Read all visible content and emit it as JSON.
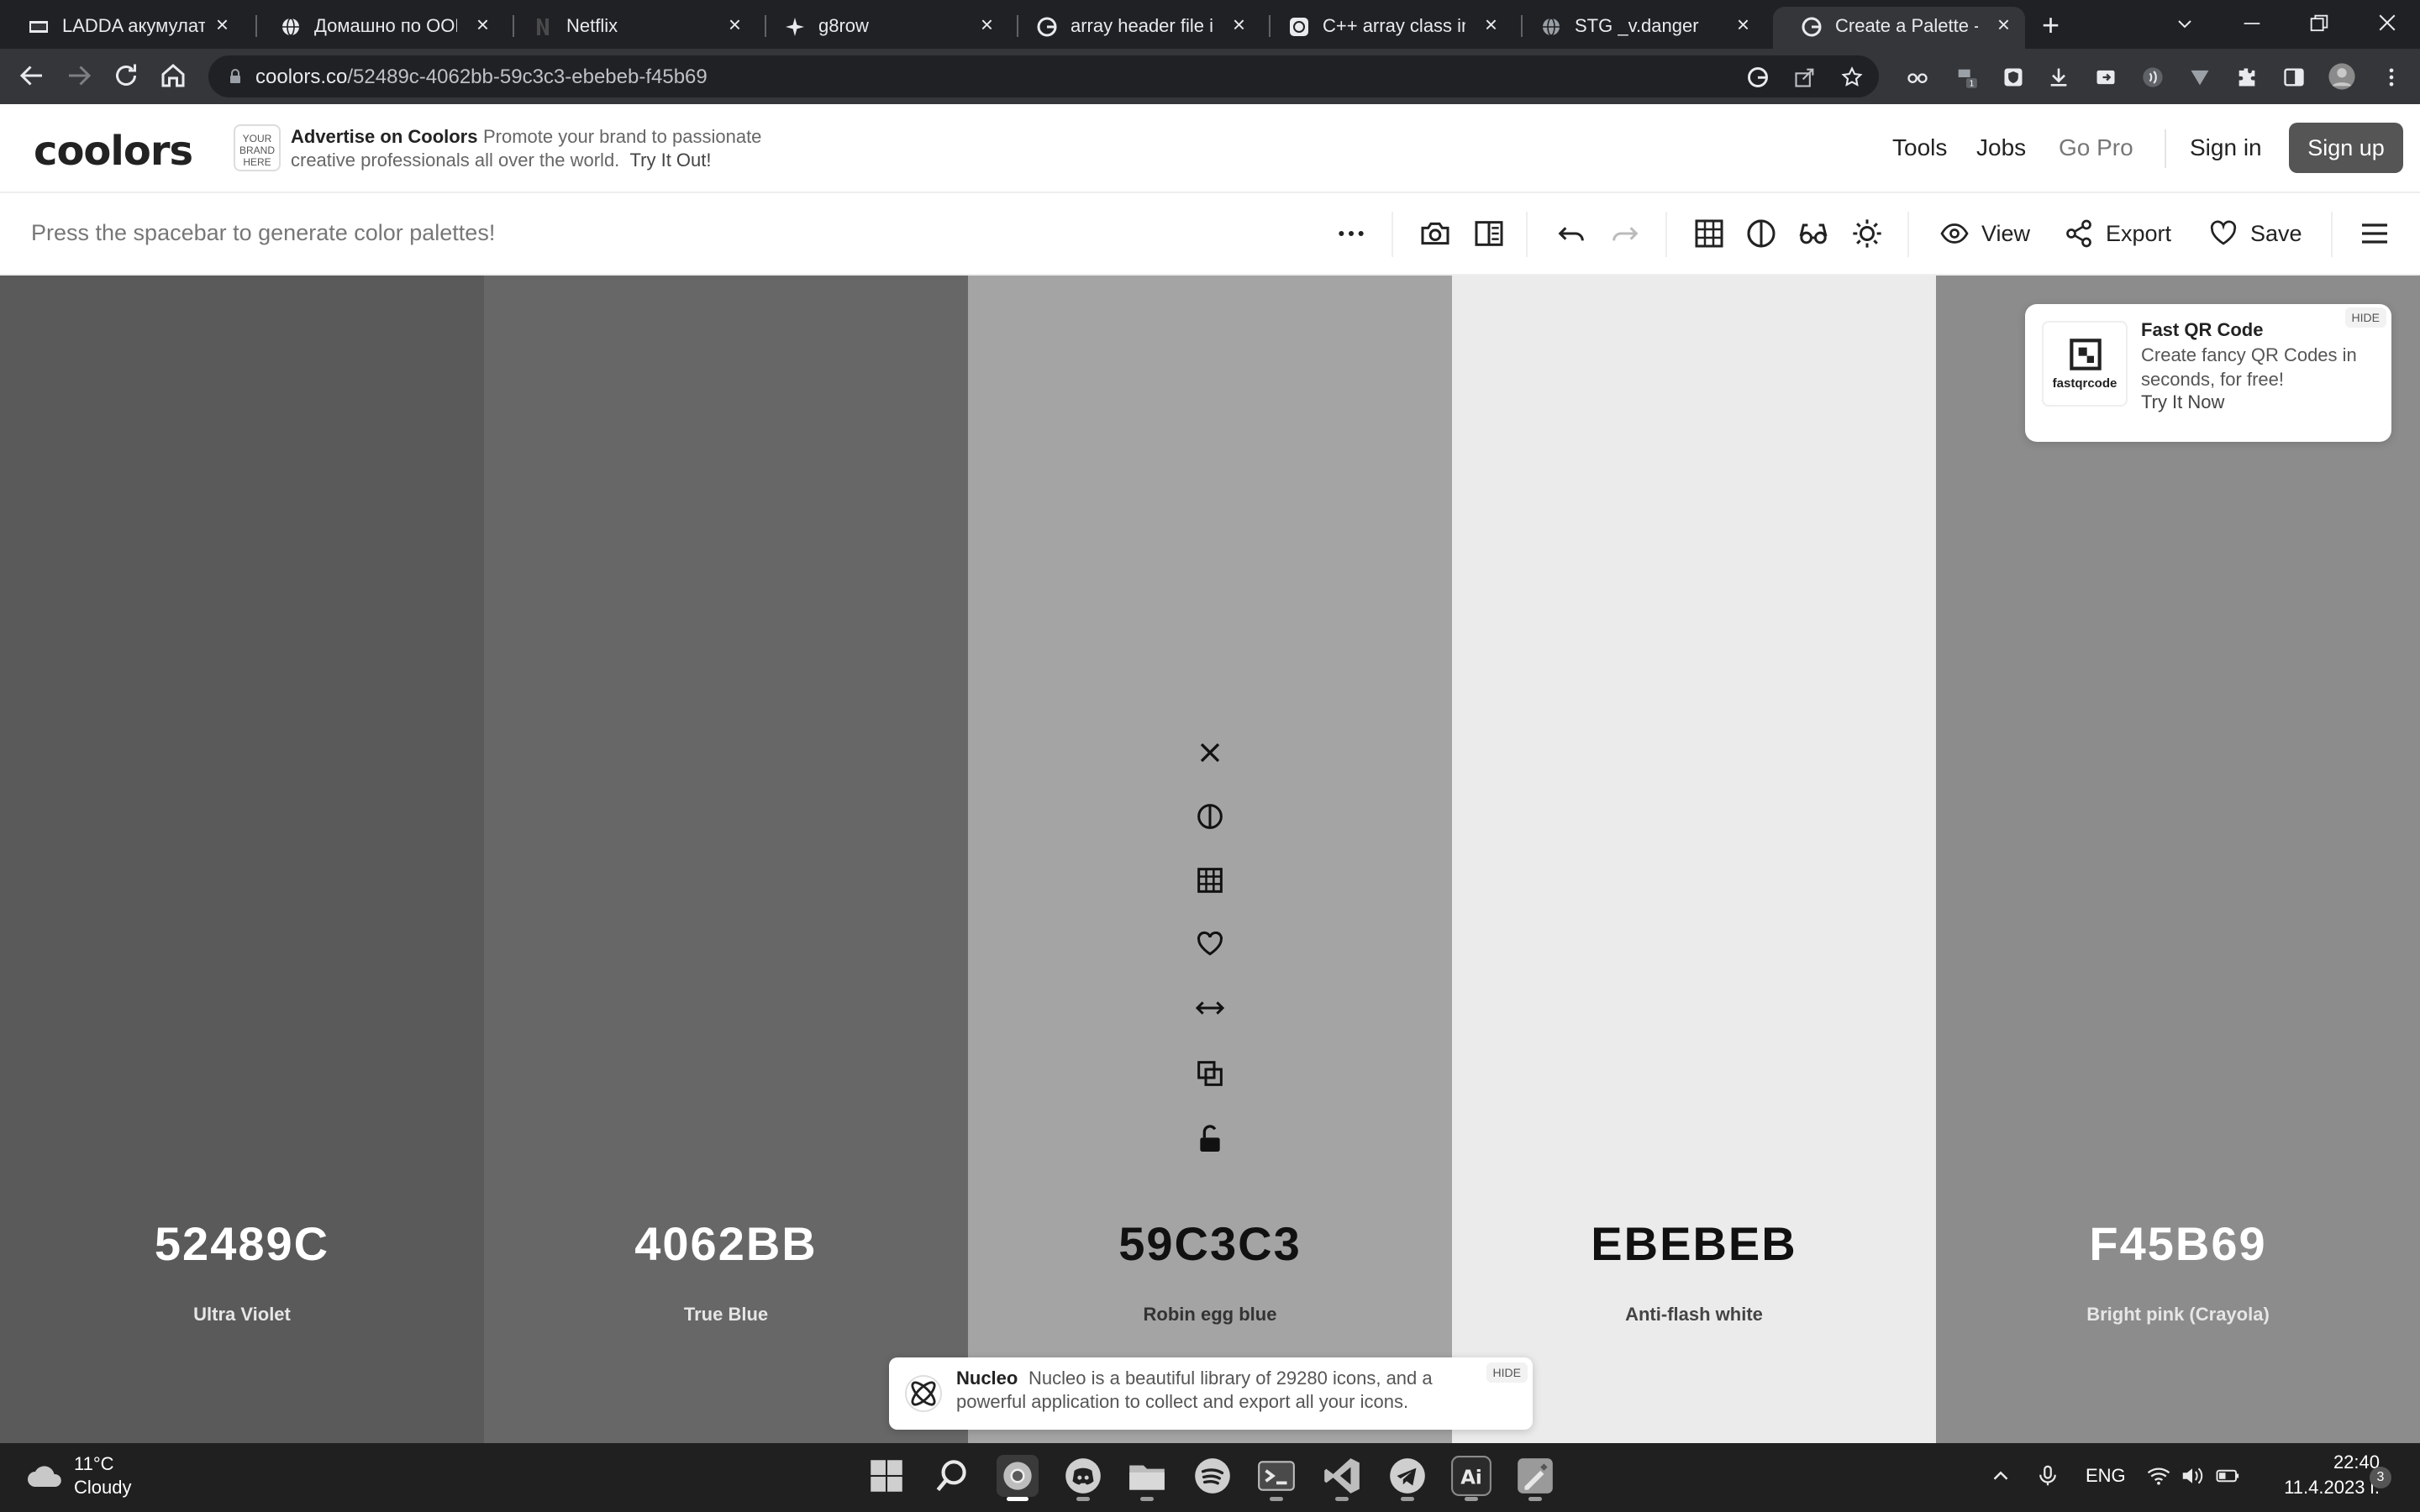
{
  "browser": {
    "tabs": [
      {
        "label": "LADDA акумулатори",
        "favicon": "ikea-favicon"
      },
      {
        "label": "Домашно по ООП",
        "favicon": "globe-favicon"
      },
      {
        "label": "Netflix",
        "favicon": "netflix-favicon"
      },
      {
        "label": "g8row",
        "favicon": "star-favicon"
      },
      {
        "label": "array header file in c",
        "favicon": "google-favicon"
      },
      {
        "label": "C++ array class impl",
        "favicon": "openai-favicon"
      },
      {
        "label": "STG _v.danger",
        "favicon": "globe-favicon"
      },
      {
        "label": "Create a Palette - Coolors",
        "favicon": "google-favicon",
        "active": true
      }
    ],
    "tab_close": "×",
    "new_tab": "+",
    "url_host": "coolors.co",
    "url_path": "/52489c-4062bb-59c3c3-ebebeb-f45b69",
    "ext_badge": "1"
  },
  "header": {
    "logo": "coolors",
    "ad_badge": "YOUR BRAND HERE",
    "ad_title": "Advertise on Coolors",
    "ad_body_line1": "Promote your brand to passionate",
    "ad_body_line2": "creative professionals all over the world.",
    "ad_cta": "Try It Out!",
    "nav": {
      "tools": "Tools",
      "jobs": "Jobs",
      "gopro": "Go Pro",
      "signin": "Sign in",
      "signup": "Sign up"
    }
  },
  "toolbar": {
    "hint": "Press the spacebar to generate color palettes!",
    "view": "View",
    "export": "Export",
    "save": "Save"
  },
  "palette": [
    {
      "hex": "52489C",
      "name": "Ultra Violet",
      "bg": "#5a5a5a",
      "fg": "#ffffff",
      "sub": "#e6e6e6"
    },
    {
      "hex": "4062BB",
      "name": "True Blue",
      "bg": "#676767",
      "fg": "#ffffff",
      "sub": "#e6e6e6"
    },
    {
      "hex": "59C3C3",
      "name": "Robin egg blue",
      "bg": "#a4a4a4",
      "fg": "#111111",
      "sub": "#333333"
    },
    {
      "hex": "EBEBEB",
      "name": "Anti-flash white",
      "bg": "#ebebeb",
      "fg": "#111111",
      "sub": "#444444"
    },
    {
      "hex": "F45B69",
      "name": "Bright pink (Crayola)",
      "bg": "#8c8c8c",
      "fg": "#ffffff",
      "sub": "#e6e6e6"
    }
  ],
  "qr_ad": {
    "logo_text": "fastqrcode",
    "title": "Fast QR Code",
    "body": "Create fancy QR Codes in seconds, for free!",
    "cta": "Try It Now",
    "hide": "HIDE"
  },
  "nucleo_ad": {
    "title": "Nucleo",
    "body_line1": "Nucleo is a beautiful library of 29280 icons, and a",
    "body_line2": "powerful application to collect and export all your icons.",
    "hide": "HIDE"
  },
  "taskbar": {
    "weather_temp": "11°C",
    "weather_condition": "Cloudy",
    "language": "ENG",
    "time": "22:40",
    "date": "11.4.2023 г.",
    "notifications": "3"
  }
}
